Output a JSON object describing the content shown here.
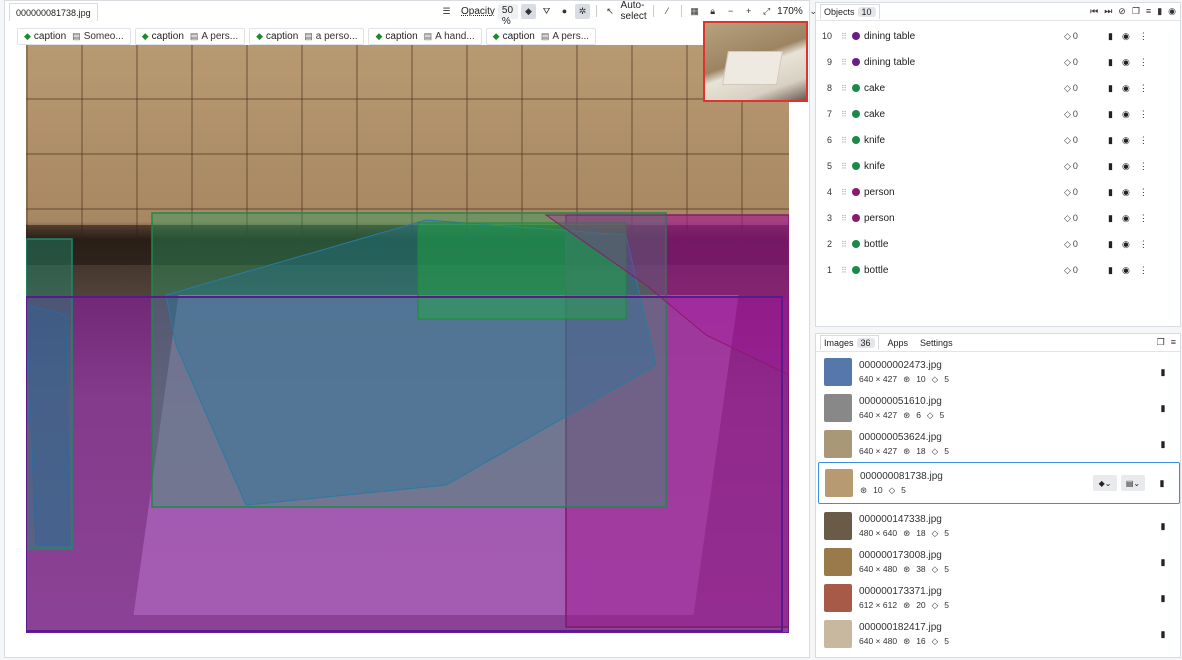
{
  "file_tab": "000000081738.jpg",
  "toolbar": {
    "opacity_label": "Opacity",
    "opacity_value": "50 %",
    "auto_select": "Auto-select",
    "zoom": "170%"
  },
  "captions": [
    {
      "tag": "caption",
      "text": "Someo..."
    },
    {
      "tag": "caption",
      "text": "A pers..."
    },
    {
      "tag": "caption",
      "text": "a perso..."
    },
    {
      "tag": "caption",
      "text": "A hand..."
    },
    {
      "tag": "caption",
      "text": "A pers..."
    }
  ],
  "objects": {
    "title": "Objects",
    "count": "10",
    "items": [
      {
        "idx": "10",
        "label": "dining table",
        "color": "#6a1b8a",
        "tags": "0"
      },
      {
        "idx": "9",
        "label": "dining table",
        "color": "#6a1b8a",
        "tags": "0"
      },
      {
        "idx": "8",
        "label": "cake",
        "color": "#1a8a4a",
        "tags": "0"
      },
      {
        "idx": "7",
        "label": "cake",
        "color": "#1a8a4a",
        "tags": "0"
      },
      {
        "idx": "6",
        "label": "knife",
        "color": "#1a8a4a",
        "tags": "0"
      },
      {
        "idx": "5",
        "label": "knife",
        "color": "#1a8a4a",
        "tags": "0"
      },
      {
        "idx": "4",
        "label": "person",
        "color": "#8a1b6a",
        "tags": "0"
      },
      {
        "idx": "3",
        "label": "person",
        "color": "#8a1b6a",
        "tags": "0"
      },
      {
        "idx": "2",
        "label": "bottle",
        "color": "#1a8a4a",
        "tags": "0"
      },
      {
        "idx": "1",
        "label": "bottle",
        "color": "#1a8a4a",
        "tags": "0"
      }
    ]
  },
  "images": {
    "tabs": [
      "Images",
      "Apps",
      "Settings"
    ],
    "count": "36",
    "items": [
      {
        "name": "000000002473.jpg",
        "dims": "640 × 427",
        "objects": "10",
        "tags": "5",
        "thumb": "#5577aa"
      },
      {
        "name": "000000051610.jpg",
        "dims": "640 × 427",
        "objects": "6",
        "tags": "5",
        "thumb": "#888888"
      },
      {
        "name": "000000053624.jpg",
        "dims": "640 × 427",
        "objects": "18",
        "tags": "5",
        "thumb": "#a89878"
      },
      {
        "name": "000000081738.jpg",
        "dims": "",
        "objects": "10",
        "tags": "5",
        "thumb": "#b89a72"
      },
      {
        "name": "000000147338.jpg",
        "dims": "480 × 640",
        "objects": "18",
        "tags": "5",
        "thumb": "#6a5a48"
      },
      {
        "name": "000000173008.jpg",
        "dims": "640 × 480",
        "objects": "38",
        "tags": "5",
        "thumb": "#9a7a4a"
      },
      {
        "name": "000000173371.jpg",
        "dims": "612 × 612",
        "objects": "20",
        "tags": "5",
        "thumb": "#a85a48"
      },
      {
        "name": "000000182417.jpg",
        "dims": "640 × 480",
        "objects": "16",
        "tags": "5",
        "thumb": "#c8b8a0"
      }
    ]
  }
}
